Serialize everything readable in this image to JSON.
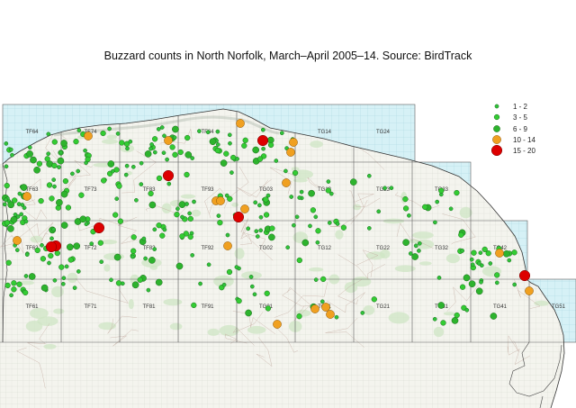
{
  "title": "Buzzard counts in North Norfolk, March–April 2005–14.  Source: BirdTrack",
  "colors": {
    "sea": "#d6f1f6",
    "sea_grid": "#a8d4de",
    "land": "#f4f4ee",
    "land_grid": "#c9cdc4",
    "grid_line": "#5c5c5c",
    "coast": "#333333",
    "outline": "#444444",
    "woodland": "#cfe5c4",
    "minor_road": "#c2a99e",
    "c1": "#2fc23a",
    "c2": "#33cc33",
    "c3": "#2db32d",
    "c4": "#f0a020",
    "c5": "#dd0000",
    "dot_stroke": "#1c6b1c",
    "dot_stroke_orange": "#8a5200",
    "dot_stroke_red": "#6a0000"
  },
  "legend": {
    "entries": [
      {
        "label": "1 - 2",
        "class": "c1"
      },
      {
        "label": "3 - 5",
        "class": "c2"
      },
      {
        "label": "6 - 9",
        "class": "c3"
      },
      {
        "label": "10 - 14",
        "class": "c4"
      },
      {
        "label": "15 - 20",
        "class": "c5"
      }
    ]
  },
  "grid_squares": [
    {
      "label": "TF64",
      "col": 0,
      "row": 0
    },
    {
      "label": "TF74",
      "col": 1,
      "row": 0
    },
    {
      "label": "TF84",
      "col": 3,
      "row": 0
    },
    {
      "label": "TG14",
      "col": 5,
      "row": 0
    },
    {
      "label": "TG24",
      "col": 6,
      "row": 0
    },
    {
      "label": "TF63",
      "col": 0,
      "row": 1
    },
    {
      "label": "TF73",
      "col": 1,
      "row": 1
    },
    {
      "label": "TF83",
      "col": 2,
      "row": 1
    },
    {
      "label": "TF93",
      "col": 3,
      "row": 1
    },
    {
      "label": "TG03",
      "col": 4,
      "row": 1
    },
    {
      "label": "TG13",
      "col": 5,
      "row": 1
    },
    {
      "label": "TG23",
      "col": 6,
      "row": 1
    },
    {
      "label": "TG33",
      "col": 7,
      "row": 1
    },
    {
      "label": "TF62",
      "col": 0,
      "row": 2
    },
    {
      "label": "TF72",
      "col": 1,
      "row": 2
    },
    {
      "label": "TF82",
      "col": 2,
      "row": 2
    },
    {
      "label": "TF92",
      "col": 3,
      "row": 2
    },
    {
      "label": "TG02",
      "col": 4,
      "row": 2
    },
    {
      "label": "TG12",
      "col": 5,
      "row": 2
    },
    {
      "label": "TG22",
      "col": 6,
      "row": 2
    },
    {
      "label": "TG32",
      "col": 7,
      "row": 2
    },
    {
      "label": "TG42",
      "col": 8,
      "row": 2
    },
    {
      "label": "TF61",
      "col": 0,
      "row": 3
    },
    {
      "label": "TF71",
      "col": 1,
      "row": 3
    },
    {
      "label": "TF81",
      "col": 2,
      "row": 3
    },
    {
      "label": "TF91",
      "col": 3,
      "row": 3
    },
    {
      "label": "TG01",
      "col": 4,
      "row": 3
    },
    {
      "label": "TG11",
      "col": 5,
      "row": 3
    },
    {
      "label": "TG21",
      "col": 6,
      "row": 3
    },
    {
      "label": "TG31",
      "col": 7,
      "row": 3
    },
    {
      "label": "TG41",
      "col": 8,
      "row": 3
    },
    {
      "label": "TG51",
      "col": 9,
      "row": 3
    }
  ]
}
